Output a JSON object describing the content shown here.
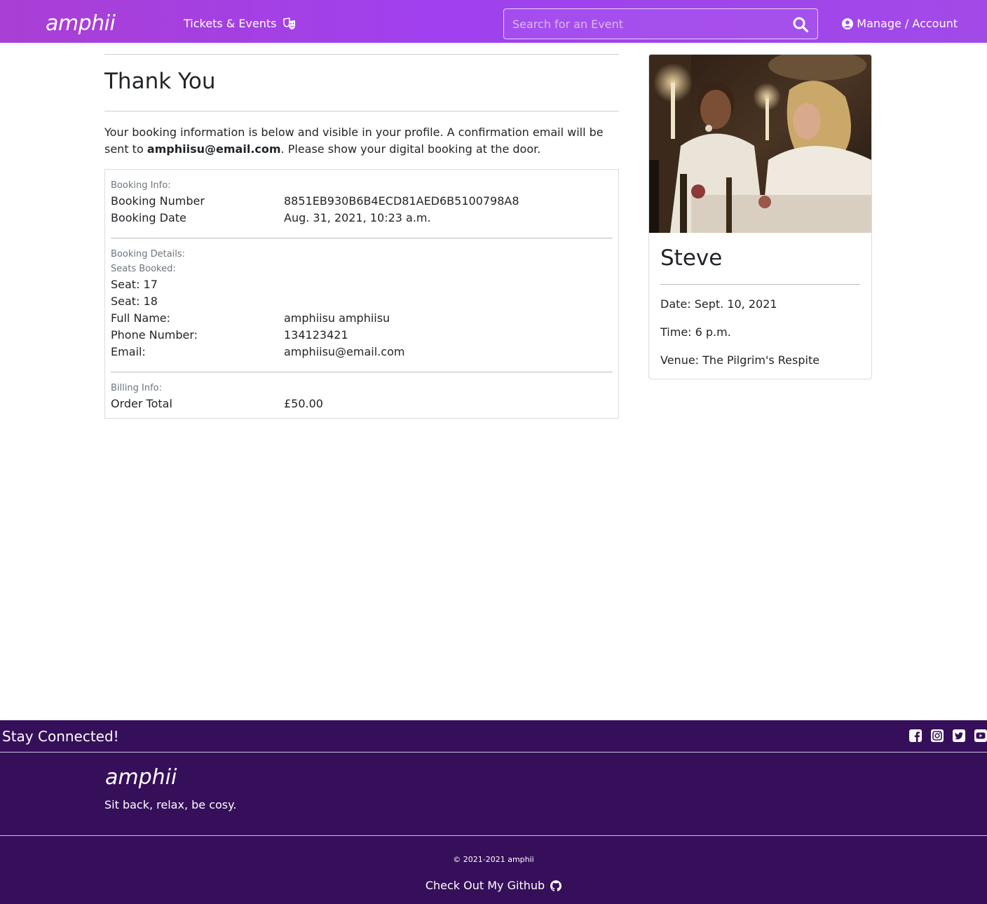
{
  "nav": {
    "brand": "amphii",
    "tickets_label": "Tickets & Events",
    "search_placeholder": "Search for an Event",
    "account_label": "Manage / Account"
  },
  "page": {
    "title": "Thank You",
    "intro_before": "Your booking information is below and visible in your profile. A confirmation email will be sent to ",
    "intro_email": "amphiisu@email.com",
    "intro_after": ". Please show your digital booking at the door."
  },
  "booking_info": {
    "label": "Booking Info:",
    "rows": [
      {
        "key": "Booking Number",
        "value": "8851EB930B6B4ECD81AED6B5100798A8"
      },
      {
        "key": "Booking Date",
        "value": "Aug. 31, 2021, 10:23 a.m."
      }
    ]
  },
  "booking_details": {
    "label": "Booking Details:",
    "seats_label": "Seats Booked:",
    "seats": [
      "Seat: 17",
      "Seat: 18"
    ],
    "rows": [
      {
        "key": "Full Name:",
        "value": "amphiisu amphiisu"
      },
      {
        "key": "Phone Number:",
        "value": "134123421"
      },
      {
        "key": "Email:",
        "value": "amphiisu@email.com"
      }
    ]
  },
  "billing_info": {
    "label": "Billing Info:",
    "rows": [
      {
        "key": "Order Total",
        "value": "£50.00"
      }
    ]
  },
  "event": {
    "name": "Steve",
    "date": "Date: Sept. 10, 2021",
    "time": "Time: 6 p.m.",
    "venue": "Venue: The Pilgrim's Respite"
  },
  "footer": {
    "stay_connected": "Stay Connected!",
    "social_icons": [
      "facebook-icon",
      "instagram-icon",
      "twitter-icon",
      "youtube-icon"
    ],
    "brand": "amphii",
    "tagline": "Sit back, relax, be cosy.",
    "copyright": "© 2021-2021 amphii",
    "github_label": "Check Out My Github"
  },
  "colors": {
    "nav_gradient_start": "#a93fd4",
    "nav_gradient_end": "#a14ae8",
    "footer_bg": "#360f5a"
  }
}
